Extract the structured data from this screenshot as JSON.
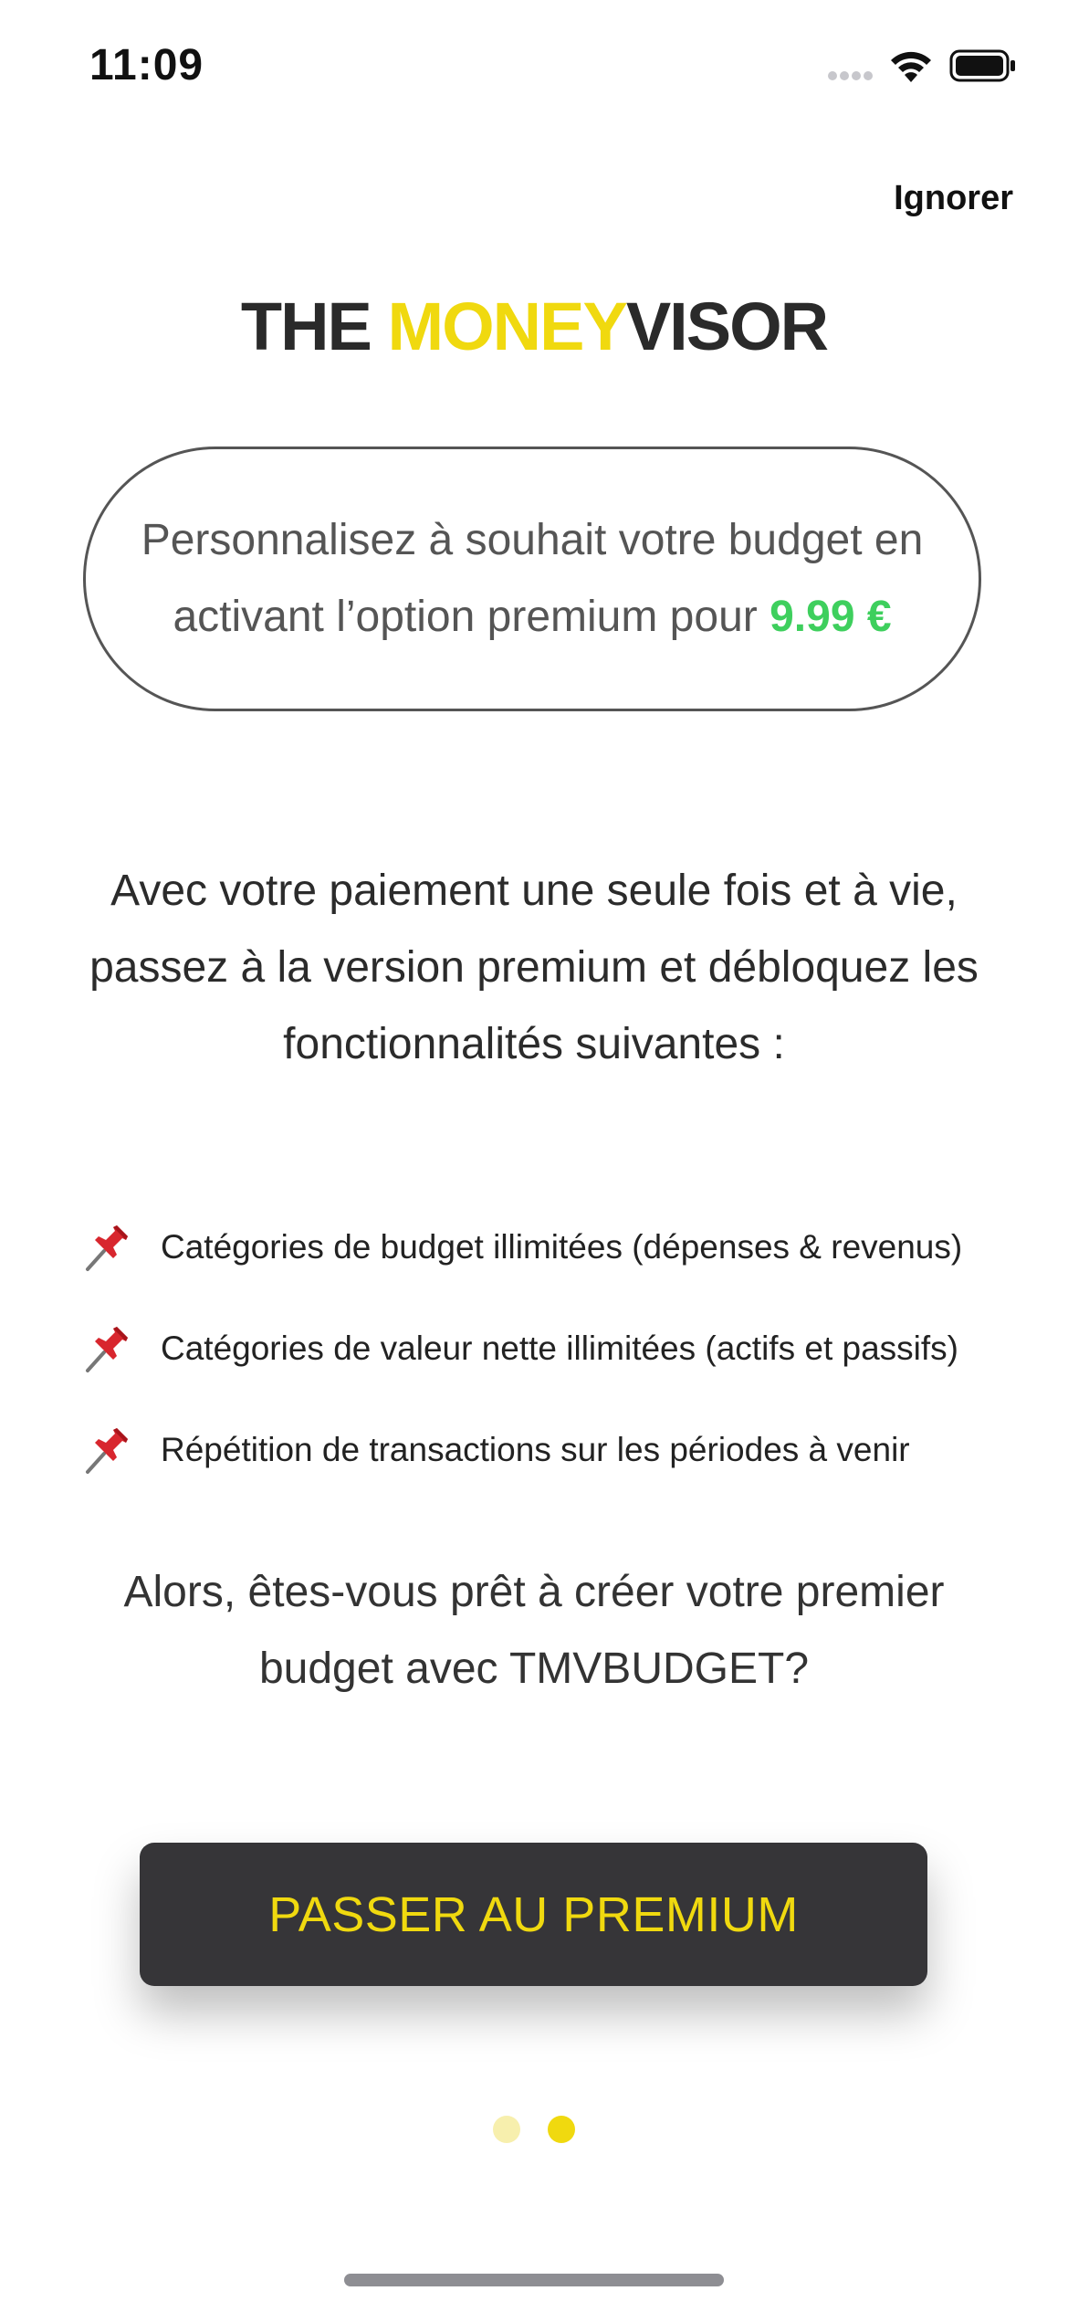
{
  "status_bar": {
    "time": "11:09",
    "icons": [
      "signal-icon",
      "wifi-icon",
      "battery-icon"
    ]
  },
  "header": {
    "skip_label": "Ignorer"
  },
  "logo": {
    "part1": "THE ",
    "part2": "MONEY",
    "part3": "VISOR"
  },
  "promo": {
    "text": "Personnalisez à souhait votre budget en activant l’option premium pour ",
    "price": "9.99 €"
  },
  "intro": {
    "text": "Avec votre paiement une seule fois et à vie, passez à la version premium et débloquez les fonctionnalités suivantes :"
  },
  "features": [
    {
      "icon": "pushpin-icon",
      "label": "Catégories de budget illimitées (dépenses & revenus)"
    },
    {
      "icon": "pushpin-icon",
      "label": "Catégories de valeur nette illimitées (actifs et passifs)"
    },
    {
      "icon": "pushpin-icon",
      "label": "Répétition de transactions sur les périodes à venir"
    }
  ],
  "question": {
    "text": "Alors, êtes-vous prêt à créer votre premier budget avec TMVBUDGET?"
  },
  "cta": {
    "label": "PASSER AU PREMIUM"
  },
  "pagination": {
    "current_page": 2,
    "total_pages": 2
  },
  "colors": {
    "accent_yellow": "#f0d90f",
    "price_green": "#3ecf5d",
    "button_bg": "#363538",
    "inactive_dot": "#f7efad"
  }
}
